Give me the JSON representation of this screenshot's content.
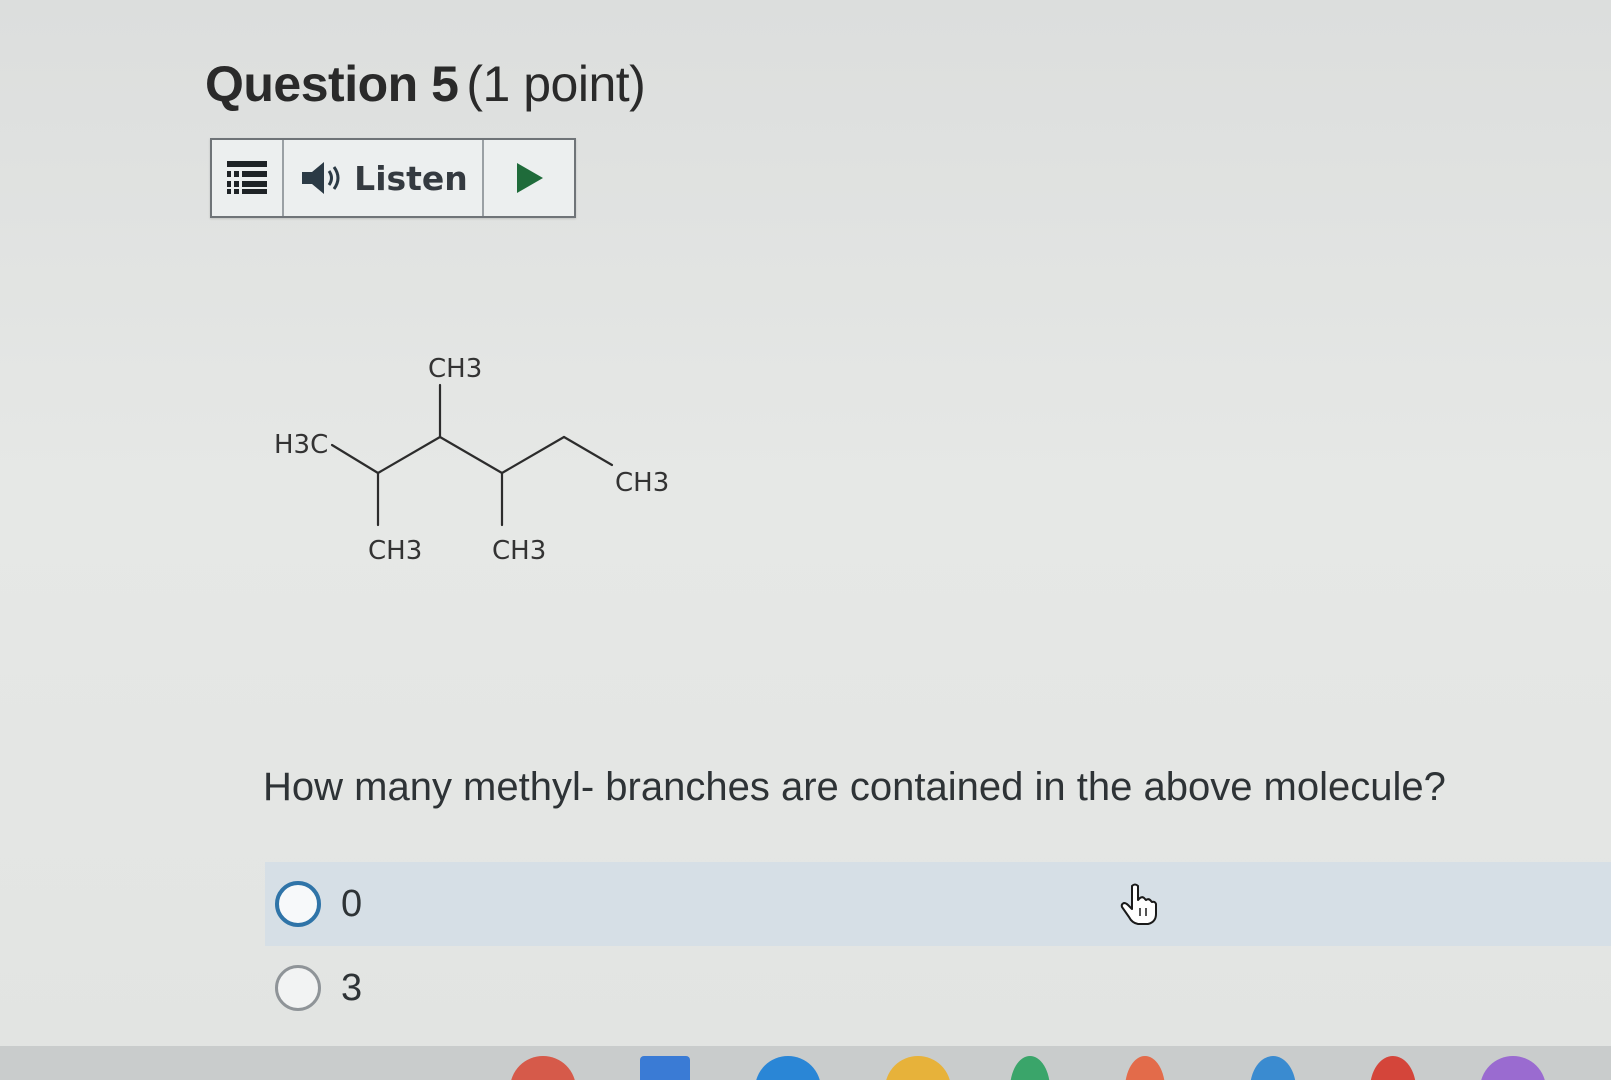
{
  "question": {
    "title": "Question 5",
    "points": "(1 point)"
  },
  "toolbar": {
    "listen_label": "Listen",
    "icons": [
      "menu-icon",
      "speaker-icon",
      "play-icon"
    ]
  },
  "molecule_labels": {
    "left_terminal": "H3C",
    "top_branch": "CH3",
    "bottom_branch_1": "CH3",
    "bottom_branch_2": "CH3",
    "right_terminal": "CH3"
  },
  "prompt": "How many methyl- branches are contained in the above molecule?",
  "options": [
    {
      "label": "0",
      "selected": false,
      "focused": true
    },
    {
      "label": "3",
      "selected": false,
      "focused": false
    }
  ],
  "colors": {
    "accent": "#2f74a8",
    "play_green": "#1f6b3a",
    "option_highlight": "#d6dfe6"
  }
}
